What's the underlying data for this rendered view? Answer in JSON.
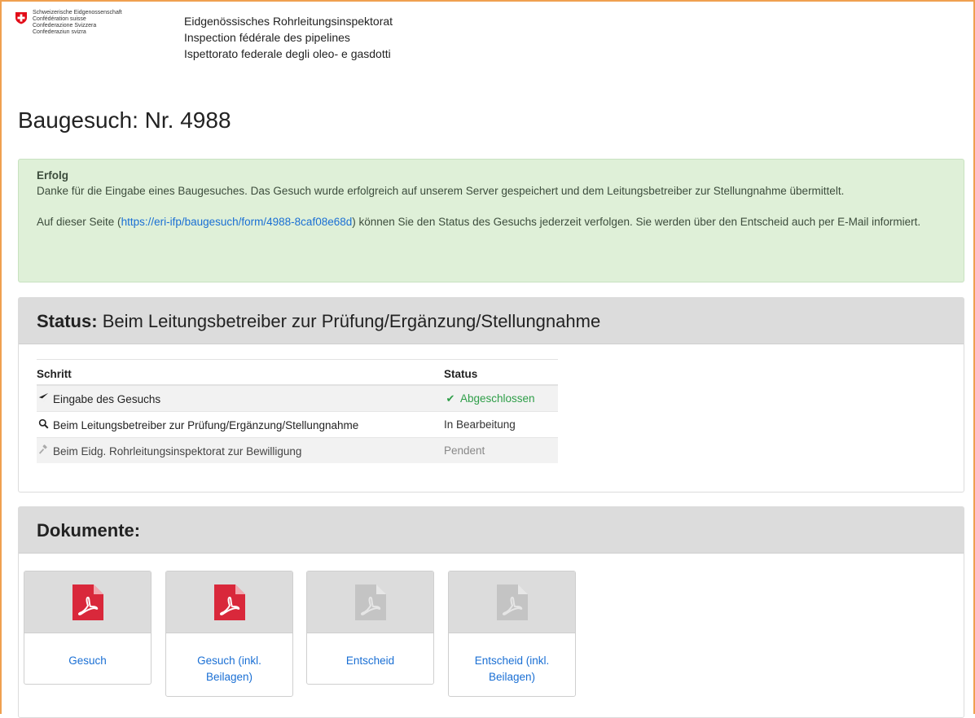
{
  "header": {
    "federation_lines": [
      "Schweizerische Eidgenossenschaft",
      "Confédération suisse",
      "Confederazione Svizzera",
      "Confederaziun svizra"
    ],
    "agency_lines": [
      "Eidgenössisches Rohrleitungsinspektorat",
      "Inspection fédérale des pipelines",
      "Ispettorato federale degli oleo- e gasdotti"
    ]
  },
  "page": {
    "title": "Baugesuch: Nr. 4988"
  },
  "alert": {
    "title": "Erfolg",
    "message1": "Danke für die Eingabe eines Baugesuches. Das Gesuch wurde erfolgreich auf unserem Server gespeichert und dem Leitungsbetreiber zur Stellungnahme übermittelt.",
    "message2_pre": "Auf dieser Seite (",
    "link": "https://eri-ifp/baugesuch/form/4988-8caf08e68d",
    "message2_post": ") können Sie den Status des Gesuchs jederzeit verfolgen. Sie werden über den Entscheid auch per E-Mail informiert."
  },
  "status": {
    "label": "Status:",
    "value": "Beim Leitungsbetreiber zur Prüfung/Ergänzung/Stellungnahme",
    "columns": [
      "Schritt",
      "Status"
    ],
    "rows": [
      {
        "icon": "paper-plane-icon",
        "step": "Eingabe des Gesuchs",
        "status": "Abgeschlossen",
        "state": "done"
      },
      {
        "icon": "search-icon",
        "step": "Beim Leitungsbetreiber zur Prüfung/Ergänzung/Stellungnahme",
        "status": "In Bearbeitung",
        "state": "wip"
      },
      {
        "icon": "gavel-icon",
        "step": "Beim Eidg. Rohrleitungsinspektorat zur Bewilligung",
        "status": "Pendent",
        "state": "pending"
      }
    ]
  },
  "documents": {
    "heading": "Dokumente:",
    "items": [
      {
        "label": "Gesuch",
        "available": true
      },
      {
        "label": "Gesuch (inkl. Beilagen)",
        "available": true
      },
      {
        "label": "Entscheid",
        "available": false
      },
      {
        "label": "Entscheid (inkl. Beilagen)",
        "available": false
      }
    ]
  },
  "colors": {
    "pdf_active": "#d9283b",
    "pdf_inactive": "#c4c4c4",
    "success": "#2e9e48",
    "link": "#1a6fd4",
    "alert_bg": "#dff0d8",
    "frame": "#f0a050"
  }
}
